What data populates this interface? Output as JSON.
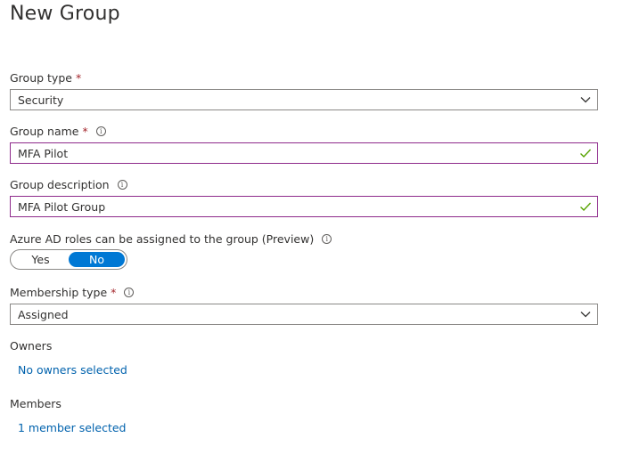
{
  "page": {
    "title": "New Group"
  },
  "group_type": {
    "label": "Group type",
    "required_mark": "*",
    "value": "Security"
  },
  "group_name": {
    "label": "Group name",
    "required_mark": "*",
    "value": "MFA Pilot"
  },
  "group_description": {
    "label": "Group description",
    "value": "MFA Pilot Group"
  },
  "azure_roles": {
    "label": "Azure AD roles can be assigned to the group (Preview)",
    "options": [
      "Yes",
      "No"
    ],
    "selected": "No"
  },
  "membership_type": {
    "label": "Membership type",
    "required_mark": "*",
    "value": "Assigned"
  },
  "owners": {
    "label": "Owners",
    "link": "No owners selected"
  },
  "members": {
    "label": "Members",
    "link": "1 member selected"
  },
  "colors": {
    "accent": "#0078d4",
    "link": "#0062ad",
    "required": "#a4262c",
    "focus_border": "#8e2a8b",
    "valid_check": "#57a300"
  }
}
